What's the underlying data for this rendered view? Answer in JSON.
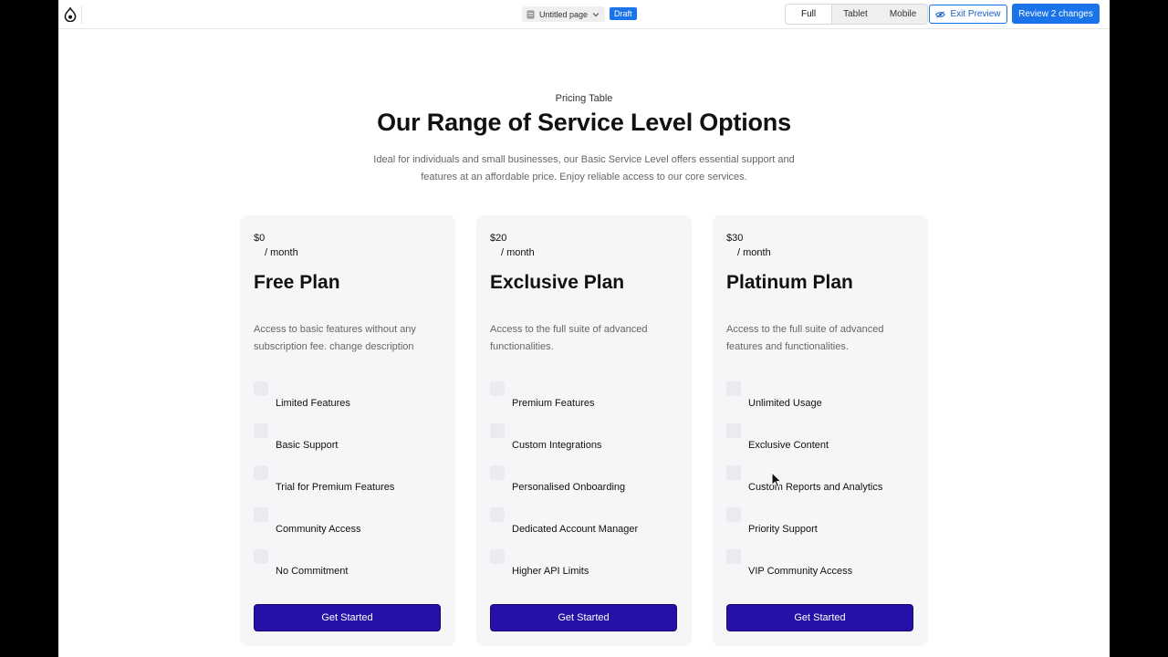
{
  "toolbar": {
    "page_name": "Untitled page",
    "draft_label": "Draft",
    "viewports": [
      "Full",
      "Tablet",
      "Mobile"
    ],
    "active_viewport": "Full",
    "exit_label": "Exit Preview",
    "review_label": "Review 2 changes",
    "accent_color": "#1a73e8"
  },
  "header": {
    "eyebrow": "Pricing Table",
    "title": "Our Range of Service Level Options",
    "description": "Ideal for individuals and small businesses, our Basic Service Level offers essential support and features at an affordable price. Enjoy reliable access to our core services."
  },
  "plans": [
    {
      "price": "$0",
      "period": "/ month",
      "name": "Free Plan",
      "description": "Access to basic features without any subscription fee. change description",
      "features": [
        "Limited Features",
        "Basic Support",
        "Trial for Premium Features",
        "Community Access",
        "No Commitment"
      ],
      "cta": "Get Started"
    },
    {
      "price": "$20",
      "period": "/ month",
      "name": "Exclusive Plan",
      "description": "Access to the full suite of advanced functionalities.",
      "features": [
        "Premium Features",
        "Custom Integrations",
        "Personalised Onboarding",
        "Dedicated Account Manager",
        "Higher API Limits"
      ],
      "cta": "Get Started"
    },
    {
      "price": "$30",
      "period": "/ month",
      "name": "Platinum Plan",
      "description": "Access to the full suite of advanced features and functionalities.",
      "features": [
        "Unlimited Usage",
        "Exclusive Content",
        "Custom Reports and Analytics",
        "Priority Support",
        "VIP Community Access"
      ],
      "cta": "Get Started"
    }
  ],
  "colors": {
    "cta_background": "#2611a8",
    "card_background": "#f6f6f8"
  }
}
